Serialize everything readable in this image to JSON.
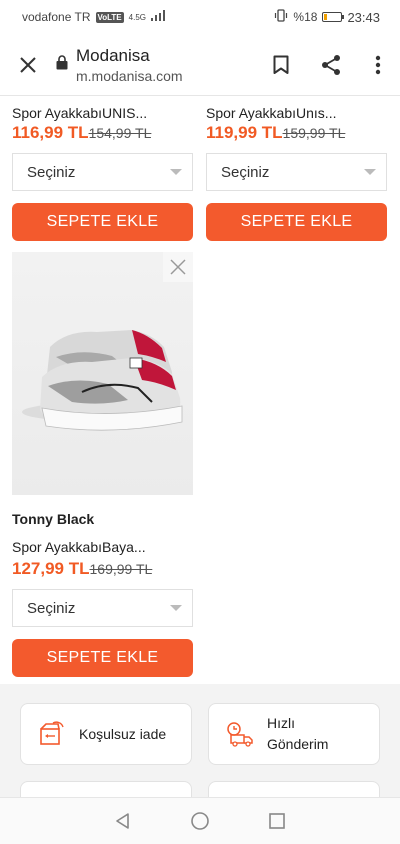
{
  "status_bar": {
    "carrier": "vodafone TR",
    "volte": "VoLTE",
    "network": "4.5G",
    "battery_text": "%18",
    "battery_level": 0.18,
    "time": "23:43"
  },
  "browser": {
    "site_title": "Modanisa",
    "site_url": "m.modanisa.com"
  },
  "products": [
    {
      "brand": "",
      "name": "Spor AyakkabıUNIS...",
      "price": "116,99 TL",
      "old_price": "154,99 TL",
      "size_select": "Seçiniz",
      "add_button": "SEPETE EKLE"
    },
    {
      "brand": "",
      "name": "Spor AyakkabıUnıs...",
      "price": "119,99 TL",
      "old_price": "159,99 TL",
      "size_select": "Seçiniz",
      "add_button": "SEPETE EKLE"
    },
    {
      "brand": "Tonny Black",
      "name": "Spor AyakkabıBaya...",
      "price": "127,99 TL",
      "old_price": "169,99 TL",
      "size_select": "Seçiniz",
      "add_button": "SEPETE EKLE"
    }
  ],
  "features": [
    {
      "label": "Koşulsuz iade",
      "icon": "return-box-icon"
    },
    {
      "label_line1": "Hızlı",
      "label_line2": "Gönderim",
      "icon": "fast-delivery-truck-icon"
    }
  ],
  "colors": {
    "accent": "#f35a2d",
    "price": "#f15a24"
  }
}
